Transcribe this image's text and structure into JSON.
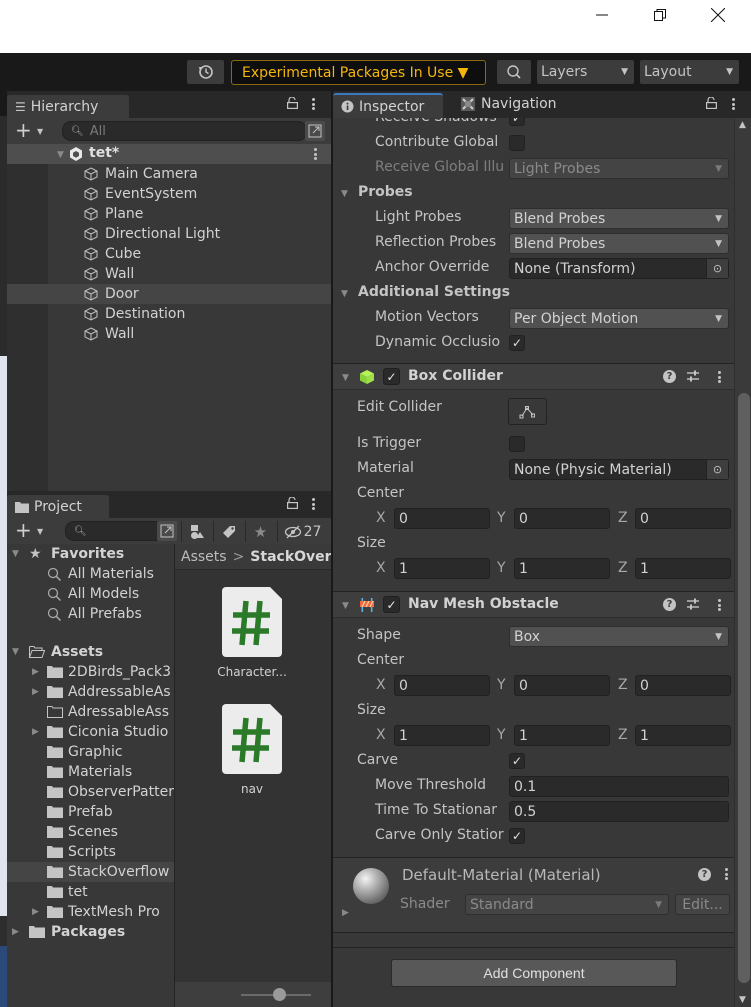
{
  "window": {
    "minimize_icon": "minimize-icon",
    "maximize_icon": "restore-icon",
    "close_icon": "close-icon"
  },
  "toolbar": {
    "history_icon": "history-icon",
    "experimental_label": "Experimental Packages In Use ▼",
    "search_icon": "search-icon",
    "layers_label": "Layers",
    "layout_label": "Layout",
    "accent_color": "#f5b70c"
  },
  "hierarchy": {
    "tab_label": "Hierarchy",
    "search_placeholder": "All",
    "scene": "tet*",
    "items": [
      {
        "label": "Main Camera",
        "selected": false
      },
      {
        "label": "EventSystem",
        "selected": false
      },
      {
        "label": "Plane",
        "selected": false
      },
      {
        "label": "Directional Light",
        "selected": false
      },
      {
        "label": "Cube",
        "selected": false
      },
      {
        "label": "Wall",
        "selected": false
      },
      {
        "label": "Door",
        "selected": true
      },
      {
        "label": "Destination",
        "selected": false
      },
      {
        "label": "Wall",
        "selected": false
      }
    ]
  },
  "project": {
    "tab_label": "Project",
    "search_placeholder": "",
    "hidden_count": "27",
    "favorites_label": "Favorites",
    "favorites": [
      "All Materials",
      "All Models",
      "All Prefabs"
    ],
    "assets_label": "Assets",
    "assets": [
      {
        "label": "2DBirds_Pack3",
        "expandable": true,
        "empty": false,
        "selected": false
      },
      {
        "label": "AddressableAs",
        "expandable": true,
        "empty": false,
        "selected": false
      },
      {
        "label": "AdressableAss",
        "expandable": false,
        "empty": true,
        "selected": false
      },
      {
        "label": "Ciconia Studio",
        "expandable": true,
        "empty": false,
        "selected": false
      },
      {
        "label": "Graphic",
        "expandable": false,
        "empty": false,
        "selected": false
      },
      {
        "label": "Materials",
        "expandable": false,
        "empty": false,
        "selected": false
      },
      {
        "label": "ObserverPatter",
        "expandable": false,
        "empty": false,
        "selected": false
      },
      {
        "label": "Prefab",
        "expandable": false,
        "empty": false,
        "selected": false
      },
      {
        "label": "Scenes",
        "expandable": false,
        "empty": false,
        "selected": false
      },
      {
        "label": "Scripts",
        "expandable": false,
        "empty": false,
        "selected": false
      },
      {
        "label": "StackOverflow",
        "expandable": false,
        "empty": false,
        "selected": true
      },
      {
        "label": "tet",
        "expandable": false,
        "empty": false,
        "selected": false
      },
      {
        "label": "TextMesh Pro",
        "expandable": true,
        "empty": false,
        "selected": false
      }
    ],
    "packages_label": "Packages",
    "breadcrumb": {
      "root": "Assets",
      "separator": ">",
      "current": "StackOver"
    },
    "files": [
      {
        "name": "Character...",
        "type": "csharp-script"
      },
      {
        "name": "nav",
        "type": "csharp-script"
      }
    ],
    "script_icon_color": "#2a7a2a"
  },
  "inspector": {
    "tab_label": "Inspector",
    "nav_tab_label": "Navigation",
    "renderer": {
      "receive_shadows_label": "Receive Shadows",
      "receive_shadows": true,
      "contribute_global_label": "Contribute Global",
      "contribute_global": false,
      "receive_gi_label": "Receive Global Illu",
      "receive_gi_value": "Light Probes",
      "probes_label": "Probes",
      "light_probes_label": "Light Probes",
      "light_probes_value": "Blend Probes",
      "reflection_probes_label": "Reflection Probes",
      "reflection_probes_value": "Blend Probes",
      "anchor_override_label": "Anchor Override",
      "anchor_override_value": "None (Transform)",
      "additional_label": "Additional Settings",
      "motion_vectors_label": "Motion Vectors",
      "motion_vectors_value": "Per Object Motion",
      "dynamic_occlusion_label": "Dynamic Occlusio",
      "dynamic_occlusion": true
    },
    "box_collider": {
      "title": "Box Collider",
      "enabled": true,
      "edit_collider_label": "Edit Collider",
      "is_trigger_label": "Is Trigger",
      "is_trigger": false,
      "material_label": "Material",
      "material_value": "None (Physic Material)",
      "center_label": "Center",
      "center": {
        "x": "0",
        "y": "0",
        "z": "0"
      },
      "size_label": "Size",
      "size": {
        "x": "1",
        "y": "1",
        "z": "1"
      }
    },
    "nav_mesh_obstacle": {
      "title": "Nav Mesh Obstacle",
      "enabled": true,
      "shape_label": "Shape",
      "shape_value": "Box",
      "center_label": "Center",
      "center": {
        "x": "0",
        "y": "0",
        "z": "0"
      },
      "size_label": "Size",
      "size": {
        "x": "1",
        "y": "1",
        "z": "1"
      },
      "carve_label": "Carve",
      "carve": true,
      "move_threshold_label": "Move Threshold",
      "move_threshold": "0.1",
      "time_to_stationary_label": "Time To Stationar",
      "time_to_stationary": "0.5",
      "carve_only_stationary_label": "Carve Only Statior",
      "carve_only_stationary": true
    },
    "material": {
      "title": "Default-Material (Material)",
      "shader_label": "Shader",
      "shader_value": "Standard",
      "edit_label": "Edit..."
    },
    "axis_labels": {
      "x": "X",
      "y": "Y",
      "z": "Z"
    },
    "add_component_label": "Add Component"
  }
}
